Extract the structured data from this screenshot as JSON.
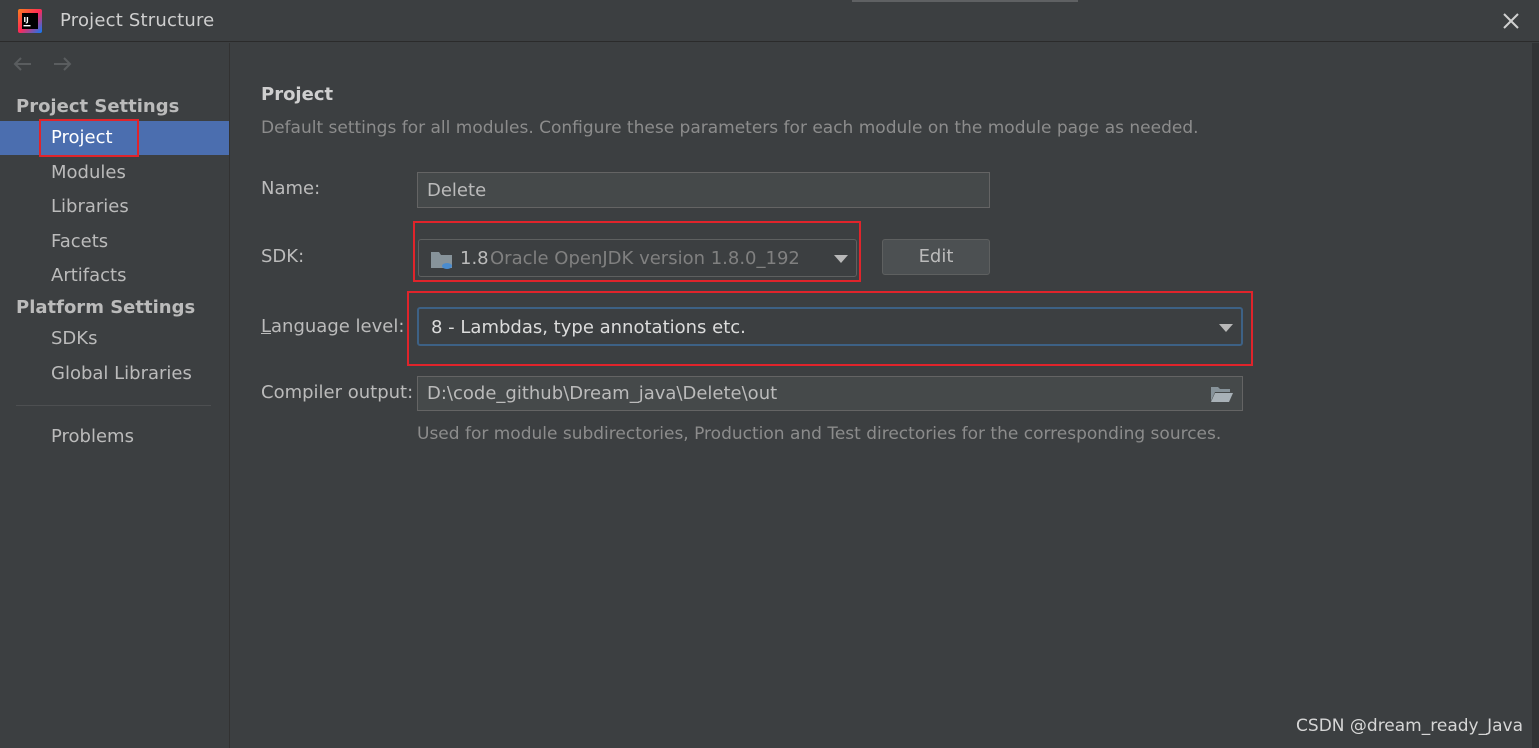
{
  "window": {
    "title": "Project Structure"
  },
  "sidebar": {
    "section_project_settings": "Project Settings",
    "section_platform_settings": "Platform Settings",
    "items": [
      {
        "label": "Project",
        "selected": true
      },
      {
        "label": "Modules"
      },
      {
        "label": "Libraries"
      },
      {
        "label": "Facets"
      },
      {
        "label": "Artifacts"
      },
      {
        "label": "SDKs"
      },
      {
        "label": "Global Libraries"
      },
      {
        "label": "Problems"
      }
    ]
  },
  "main": {
    "heading": "Project",
    "description": "Default settings for all modules. Configure these parameters for each module on the module page as needed.",
    "name_label": "Name:",
    "name_value": "Delete",
    "sdk_label": "SDK:",
    "sdk_version": "1.8",
    "sdk_detail": "Oracle OpenJDK version 1.8.0_192",
    "edit_button": "Edit",
    "language_level_label_first": "L",
    "language_level_label_rest": "anguage level:",
    "language_level_value": "8 - Lambdas, type annotations etc.",
    "compiler_output_label": "Compiler output:",
    "compiler_output_value": "D:\\code_github\\Dream_java\\Delete\\out",
    "compiler_output_hint": "Used for module subdirectories, Production and Test directories for the corresponding sources."
  },
  "watermark": "CSDN @dream_ready_Java",
  "colors": {
    "background": "#3c3f41",
    "selection": "#4b6eaf",
    "highlight_box": "#e0242b",
    "focus_border": "#3d6185"
  },
  "icons": {
    "app_logo": "intellij-idea-icon",
    "close": "close-icon",
    "back": "arrow-left-icon",
    "forward": "arrow-right-icon",
    "sdk": "folder-icon",
    "dropdown": "chevron-down-icon",
    "browse": "folder-open-icon"
  }
}
